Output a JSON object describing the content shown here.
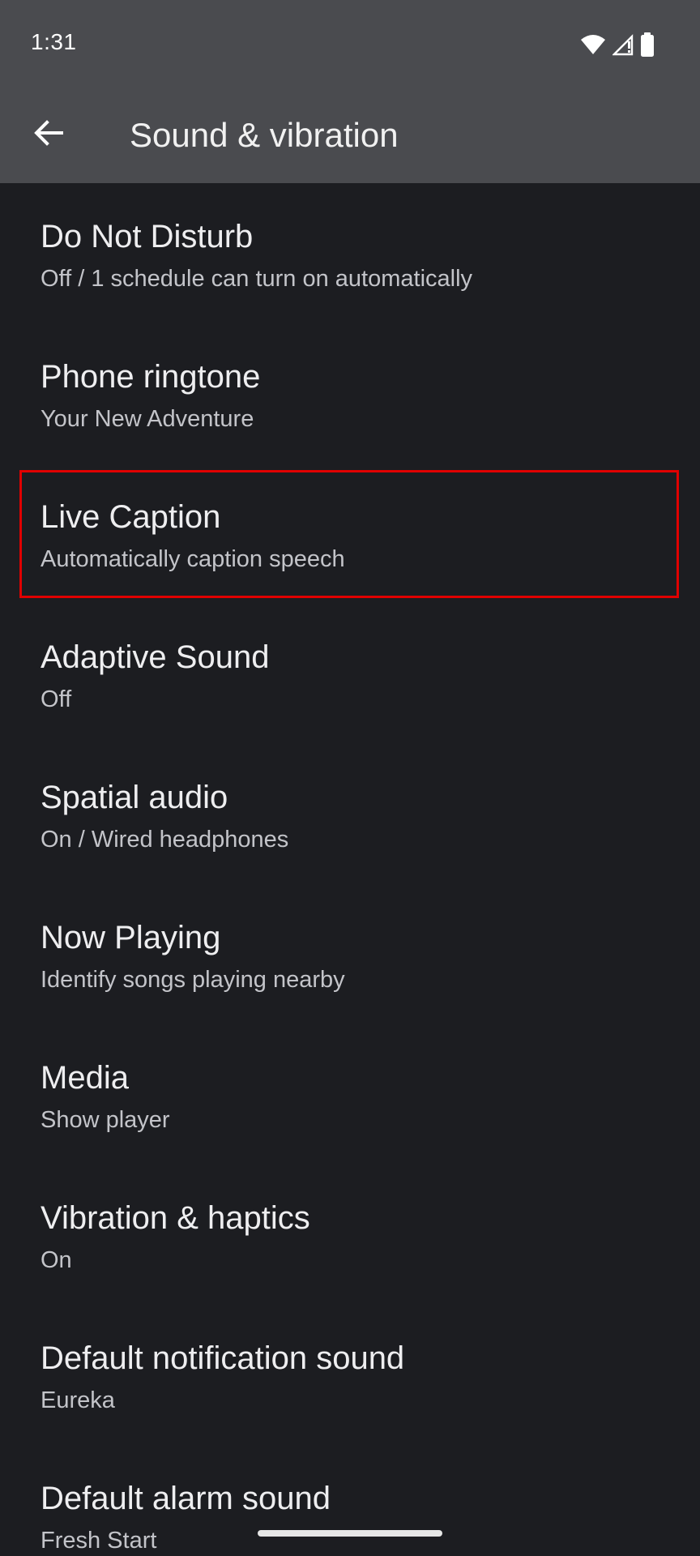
{
  "status_bar": {
    "time": "1:31",
    "icons": [
      "wifi-icon",
      "cell-signal-icon",
      "battery-icon"
    ]
  },
  "app_bar": {
    "back_icon": "arrow-back-icon",
    "title": "Sound & vibration"
  },
  "settings": [
    {
      "title": "Do Not Disturb",
      "subtitle": "Off / 1 schedule can turn on automatically"
    },
    {
      "title": "Phone ringtone",
      "subtitle": "Your New Adventure"
    },
    {
      "title": "Live Caption",
      "subtitle": "Automatically caption speech"
    },
    {
      "title": "Adaptive Sound",
      "subtitle": "Off"
    },
    {
      "title": "Spatial audio",
      "subtitle": "On / Wired headphones"
    },
    {
      "title": "Now Playing",
      "subtitle": "Identify songs playing nearby"
    },
    {
      "title": "Media",
      "subtitle": "Show player"
    },
    {
      "title": "Vibration & haptics",
      "subtitle": "On"
    },
    {
      "title": "Default notification sound",
      "subtitle": "Eureka"
    },
    {
      "title": "Default alarm sound",
      "subtitle": "Fresh Start"
    }
  ],
  "colors": {
    "background": "#1c1d21",
    "app_bar": "#4a4b4f",
    "highlight": "#e00000"
  }
}
